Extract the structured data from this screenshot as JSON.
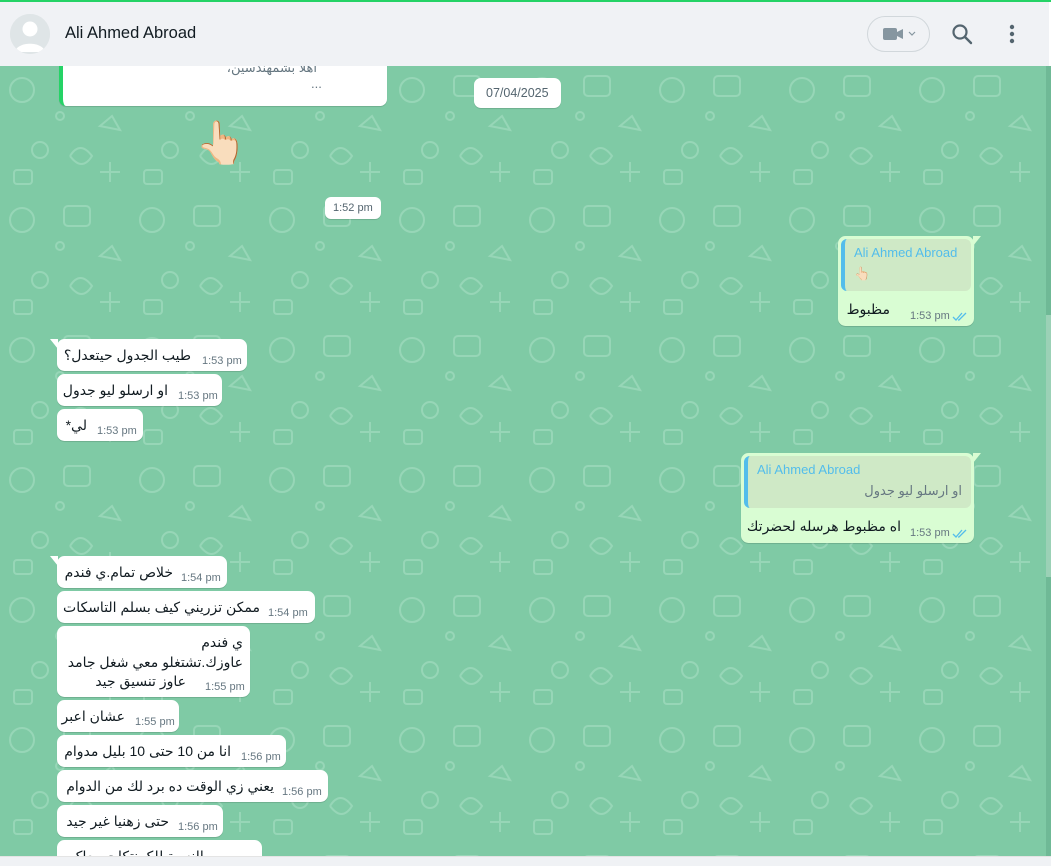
{
  "header": {
    "contact_name": "Ali Ahmed Abroad",
    "icons": [
      "avatar-placeholder",
      "video-camera-icon",
      "chevron-down-icon",
      "search-icon",
      "more-vertical-icon"
    ]
  },
  "previous_message": {
    "text": "اهلا بشمهندسين،",
    "ellipsis": "..."
  },
  "emoji_message": "👆🏻",
  "date_pills": {
    "date": "07/04/2025",
    "time": "1:52 pm"
  },
  "messages": [
    {
      "direction": "out",
      "quote_author": "Ali Ahmed Abroad",
      "quote_text": "👆🏻",
      "text": "مظبوط",
      "time": "1:53 pm",
      "status": "read"
    },
    {
      "direction": "in",
      "text": "طيب الجدول حيتعدل؟",
      "time": "1:53 pm"
    },
    {
      "direction": "in",
      "text": "او ارسلو ليو جدول",
      "time": "1:53 pm"
    },
    {
      "direction": "in",
      "text": "لي*",
      "time": "1:53 pm"
    },
    {
      "direction": "out",
      "quote_author": "Ali Ahmed Abroad",
      "quote_text": "او ارسلو ليو جدول",
      "text": "اه مظبوط هرسله لحضرتك",
      "time": "1:53 pm",
      "status": "read"
    },
    {
      "direction": "in",
      "text": "خلاص تمام.ي فندم",
      "time": "1:54 pm"
    },
    {
      "direction": "in",
      "text": "ممكن تزريني كيف بسلم التاسكات",
      "time": "1:54 pm"
    },
    {
      "direction": "in",
      "lines": [
        "ي فندم",
        "عاوزك.تشتغلو معي شغل جامد",
        "عاوز تنسيق جيد"
      ],
      "time": "1:55 pm"
    },
    {
      "direction": "in",
      "text": "عشان اعبر",
      "time": "1:55 pm"
    },
    {
      "direction": "in",
      "text": "انا من 10 حتى 10 بليل مدوام",
      "time": "1:56 pm"
    },
    {
      "direction": "in",
      "text": "يعني زي الوقت ده برد لك من الدوام",
      "time": "1:56 pm"
    },
    {
      "direction": "in",
      "text": "حتى زهنيا غير جيد",
      "time": "1:56 pm"
    },
    {
      "direction": "in",
      "text": "بالنسبة للكمنتكات معاكم",
      "time": ""
    }
  ],
  "colors": {
    "chat_bg": "#7fcaa5",
    "outgoing_bubble": "#d9fdd3",
    "incoming_bubble": "#ffffff",
    "read_ticks": "#53bdeb",
    "accent": "#25d366"
  }
}
